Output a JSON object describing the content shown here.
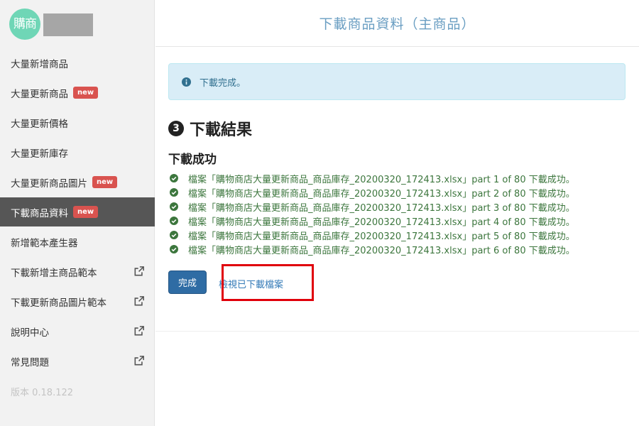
{
  "sidebar": {
    "logo_text": "購商",
    "items": [
      {
        "label": "大量新增商品",
        "badge": "",
        "external": false,
        "active": false
      },
      {
        "label": "大量更新商品",
        "badge": "new",
        "external": false,
        "active": false
      },
      {
        "label": "大量更新價格",
        "badge": "",
        "external": false,
        "active": false
      },
      {
        "label": "大量更新庫存",
        "badge": "",
        "external": false,
        "active": false
      },
      {
        "label": "大量更新商品圖片",
        "badge": "new",
        "external": false,
        "active": false
      },
      {
        "label": "下載商品資料",
        "badge": "new",
        "external": false,
        "active": true
      },
      {
        "label": "新增範本產生器",
        "badge": "",
        "external": false,
        "active": false
      },
      {
        "label": "下載新增主商品範本",
        "badge": "",
        "external": true,
        "active": false
      },
      {
        "label": "下載更新商品圖片範本",
        "badge": "",
        "external": true,
        "active": false
      },
      {
        "label": "說明中心",
        "badge": "",
        "external": true,
        "active": false
      },
      {
        "label": "常見問題",
        "badge": "",
        "external": true,
        "active": false
      }
    ],
    "version": "版本 0.18.122"
  },
  "main": {
    "title": "下載商品資料（主商品）",
    "alert_text": "下載完成。",
    "step_number": "3",
    "step_heading": "下載結果",
    "sub_heading": "下載成功",
    "results": [
      "檔案「購物商店大量更新商品_商品庫存_20200320_172413.xlsx」part 1 of 80 下載成功。",
      "檔案「購物商店大量更新商品_商品庫存_20200320_172413.xlsx」part 2 of 80 下載成功。",
      "檔案「購物商店大量更新商品_商品庫存_20200320_172413.xlsx」part 3 of 80 下載成功。",
      "檔案「購物商店大量更新商品_商品庫存_20200320_172413.xlsx」part 4 of 80 下載成功。",
      "檔案「購物商店大量更新商品_商品庫存_20200320_172413.xlsx」part 5 of 80 下載成功。",
      "檔案「購物商店大量更新商品_商品庫存_20200320_172413.xlsx」part 6 of 80 下載成功。"
    ],
    "done_button": "完成",
    "view_link": "檢視已下載檔案"
  },
  "colors": {
    "accent": "#2f6ca4",
    "active_nav": "#565656",
    "badge": "#d9534f",
    "success": "#3c763d",
    "highlight": "#e0000a"
  },
  "icons": {
    "external": "external-link-icon",
    "info": "info-circle-icon",
    "check": "check-circle-icon"
  }
}
